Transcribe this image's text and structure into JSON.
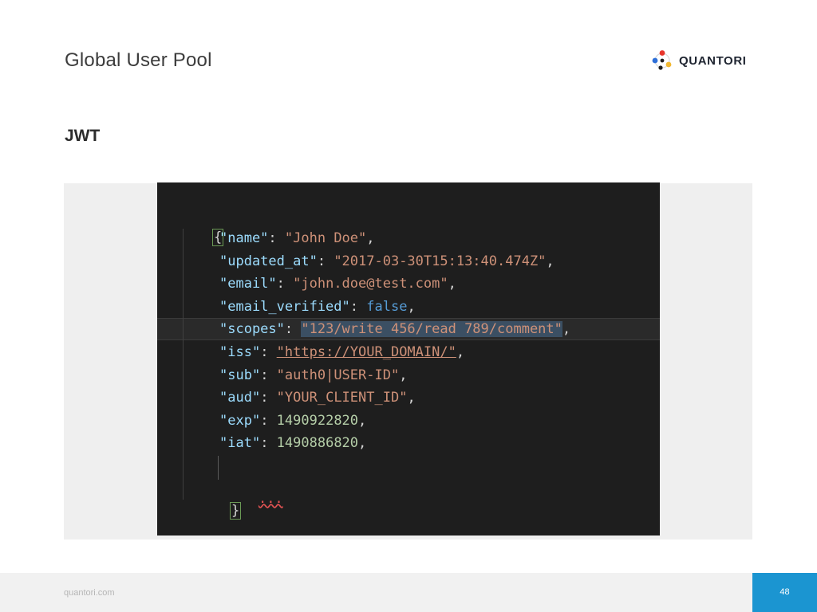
{
  "slide": {
    "title": "Global User Pool",
    "section": "JWT"
  },
  "logo": {
    "text": "QUANTORI",
    "icon": "quantori-dots-logo-icon",
    "colors": [
      "#e8352b",
      "#2e6fd8",
      "#f2b830",
      "#1f1f1f"
    ]
  },
  "code": {
    "open_brace": "{",
    "close_brace": "}",
    "ellipsis": "...",
    "lines": [
      {
        "key": "\"name\"",
        "value": "\"John Doe\"",
        "type": "string"
      },
      {
        "key": "\"updated_at\"",
        "value": "\"2017-03-30T15:13:40.474Z\"",
        "type": "string"
      },
      {
        "key": "\"email\"",
        "value": "\"john.doe@test.com\"",
        "type": "string"
      },
      {
        "key": "\"email_verified\"",
        "value": "false",
        "type": "boolean"
      },
      {
        "key": "\"scopes\"",
        "value": "\"123/write 456/read 789/comment\"",
        "type": "string",
        "selected": true
      },
      {
        "key": "\"iss\"",
        "value": "\"https://YOUR_DOMAIN/\"",
        "type": "string"
      },
      {
        "key": "\"sub\"",
        "value": "\"auth0|USER-ID\"",
        "type": "string"
      },
      {
        "key": "\"aud\"",
        "value": "\"YOUR_CLIENT_ID\"",
        "type": "string"
      },
      {
        "key": "\"exp\"",
        "value": "1490922820",
        "type": "number"
      },
      {
        "key": "\"iat\"",
        "value": "1490886820",
        "type": "number"
      }
    ]
  },
  "footer": {
    "site": "quantori.com",
    "page_number": "48"
  },
  "colors": {
    "accent": "#1b95d1",
    "code_bg": "#1e1e1e",
    "json_key": "#9cdcfe",
    "json_string": "#ce9178",
    "json_number": "#b5cea8",
    "json_boolean": "#569cd6"
  }
}
